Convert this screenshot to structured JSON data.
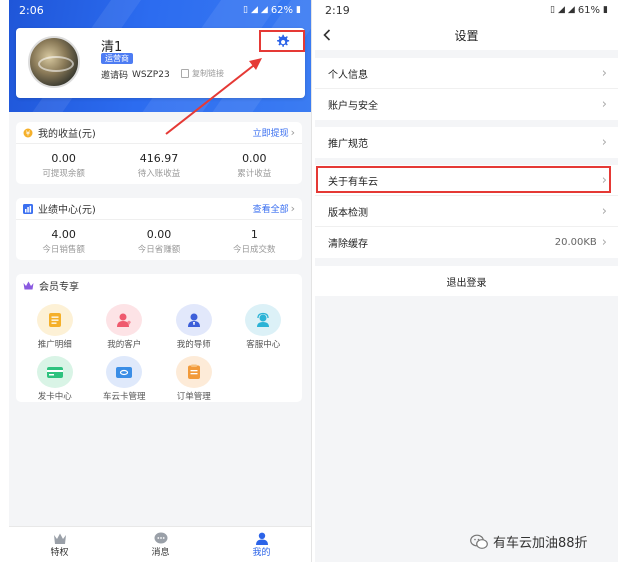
{
  "left_screen": {
    "status_bar": {
      "time": "2:06",
      "battery": "62%"
    },
    "profile": {
      "name": "清1",
      "role_badge": "运营商",
      "invite_label": "邀请码",
      "invite_code": "WSZP23",
      "copy_link": "复制链接"
    },
    "earnings": {
      "title": "我的收益(元)",
      "link": "立即提现",
      "items": [
        {
          "value": "0.00",
          "label": "可提现余额"
        },
        {
          "value": "416.97",
          "label": "待入账收益"
        },
        {
          "value": "0.00",
          "label": "累计收益"
        }
      ]
    },
    "performance": {
      "title": "业绩中心(元)",
      "link": "查看全部",
      "items": [
        {
          "value": "4.00",
          "label": "今日销售额"
        },
        {
          "value": "0.00",
          "label": "今日省赚额"
        },
        {
          "value": "1",
          "label": "今日成交数"
        }
      ]
    },
    "member": {
      "title": "会员专享",
      "items": [
        {
          "label": "推广明细",
          "icon": "document-icon"
        },
        {
          "label": "我的客户",
          "icon": "customer-icon"
        },
        {
          "label": "我的导师",
          "icon": "mentor-icon"
        },
        {
          "label": "客服中心",
          "icon": "support-icon"
        },
        {
          "label": "发卡中心",
          "icon": "card-icon"
        },
        {
          "label": "车云卡管理",
          "icon": "card-manage-icon"
        },
        {
          "label": "订单管理",
          "icon": "order-icon"
        }
      ]
    },
    "tabs": [
      {
        "label": "特权",
        "icon": "crown-icon"
      },
      {
        "label": "消息",
        "icon": "message-icon"
      },
      {
        "label": "我的",
        "icon": "profile-icon"
      }
    ]
  },
  "right_screen": {
    "status_bar": {
      "time": "2:19",
      "battery": "61%"
    },
    "title": "设置",
    "group1": [
      {
        "label": "个人信息"
      },
      {
        "label": "账户与安全"
      }
    ],
    "group2": [
      {
        "label": "推广规范"
      }
    ],
    "group3": [
      {
        "label": "关于有车云"
      },
      {
        "label": "版本检测"
      },
      {
        "label": "清除缓存",
        "value": "20.00KB"
      }
    ],
    "logout": "退出登录"
  },
  "watermark": "有车云加油88折",
  "colors": {
    "primary": "#2b63e8",
    "highlight": "#e53935"
  }
}
